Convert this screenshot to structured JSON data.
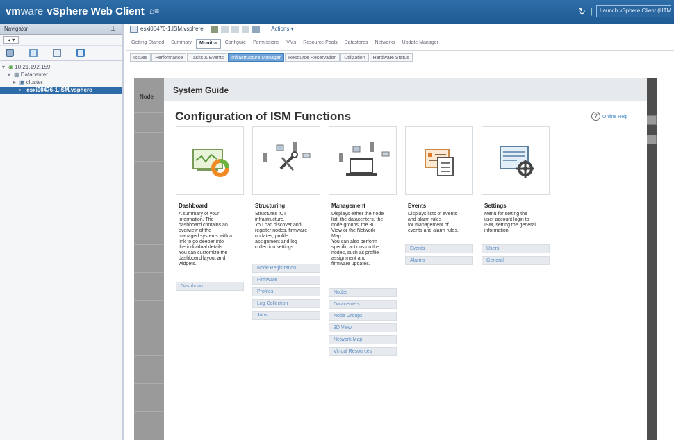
{
  "topbar": {
    "brand_vm": "vm",
    "brand_ware": "ware",
    "product": "vSphere Web Client",
    "home_icon": "home-icon",
    "menu_glyph": "≡",
    "refresh_icon": "refresh-icon",
    "launch_label": "Launch vSphere Client (HTML5)"
  },
  "navigator": {
    "title": "Navigator",
    "tree": [
      {
        "label": "10.21.192.159",
        "glyph": "▾"
      },
      {
        "label": "Datacenter",
        "glyph": "▾"
      },
      {
        "label": "cluster",
        "glyph": "▸"
      },
      {
        "label": "esxi00476-1.ISM.vsphere",
        "glyph": "▪"
      }
    ]
  },
  "object_toolbar": {
    "host_name": "esxi00476-1.ISM.vsphere",
    "actions_label": "Actions ▾"
  },
  "main_tabs": [
    "Getting Started",
    "Summary",
    "Monitor",
    "Configure",
    "Permissions",
    "VMs",
    "Resource Pools",
    "Datastores",
    "Networks",
    "Update Manager"
  ],
  "sub_tabs": [
    "Issues",
    "Performance",
    "Tasks & Events",
    "Infrastructure Manager",
    "Resource Reservation",
    "Utilization",
    "Hardware Status"
  ],
  "left_strip_label": "Node",
  "dialog": {
    "header": "System Guide",
    "title": "Configuration of ISM Functions",
    "help_label": "Online Help",
    "help_icon": "help-circle-icon"
  },
  "cards": [
    {
      "title": "Dashboard",
      "icon": "dashboard-monitor-icon",
      "description": "A summary of your\ninformation. The\ndashboard contains an\noverview of the\nmanaged systems with a\nlink to go deeper into\nthe individual details.\nYou can customize the\ndashboard layout and\nwidgets.",
      "links": [
        "Dashboard"
      ]
    },
    {
      "title": "Structuring",
      "icon": "structuring-tools-icon",
      "description": "Structures ICT\ninfrastructure.\nYou can discover and\nregister nodes, firmware\nupdates, profile\nassignment and log\ncollection settings.",
      "links": [
        "Node Registration",
        "Firmware",
        "Profiles",
        "Log Collection",
        "Jobs"
      ]
    },
    {
      "title": "Management",
      "icon": "management-network-icon",
      "description": "Displays either the node\nlist, the datacenters, the\nnode groups, the 3D\nView or the Network\nMap.\nYou can also perform\nspecific actions on the\nnodes, such as profile\nassignment and\nfirmware updates.",
      "links": [
        "Nodes",
        "Datacenters",
        "Node Groups",
        "3D View",
        "Network Map",
        "Virtual Resources"
      ]
    },
    {
      "title": "Events",
      "icon": "events-list-icon",
      "description": "Displays lists of events\nand alarm rules\nfor management of\nevents and alarm rules.",
      "links": [
        "Events",
        "Alarms"
      ]
    },
    {
      "title": "Settings",
      "icon": "settings-gear-icon",
      "description": "Menu for setting the\nuser account login to\nISM, setting the general\ninformation.",
      "links": [
        "Users",
        "General"
      ]
    }
  ]
}
